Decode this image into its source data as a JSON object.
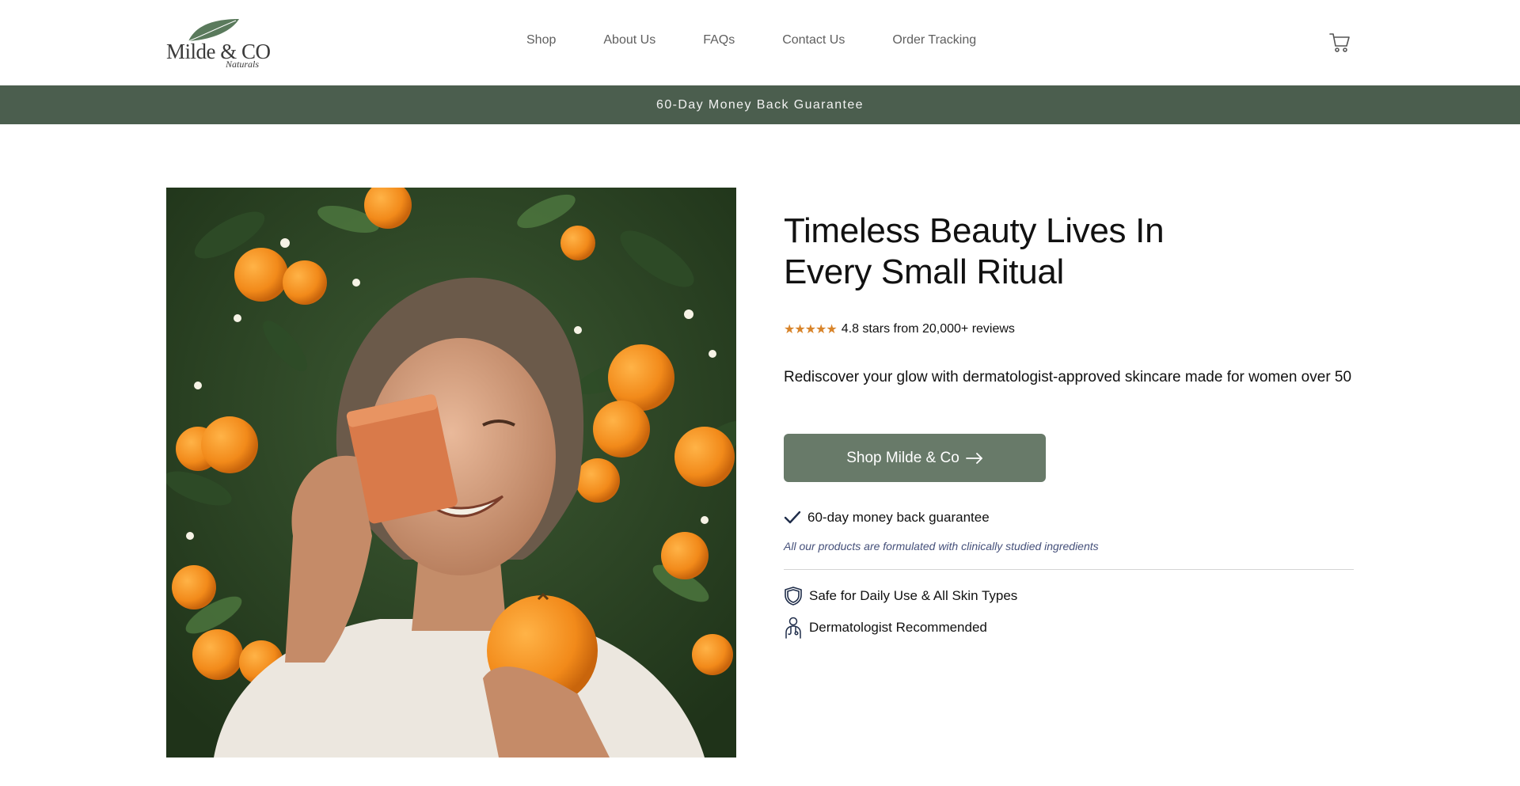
{
  "header": {
    "logo": {
      "main": "Milde & CO",
      "sub": "Naturals"
    },
    "nav": [
      "Shop",
      "About Us",
      "FAQs",
      "Contact Us",
      "Order Tracking"
    ],
    "cart_icon": "cart-icon"
  },
  "announcement": {
    "text": "60-Day Money Back Guarantee"
  },
  "hero": {
    "image_alt_icon": "hero-photo",
    "title_line1": "Timeless Beauty Lives In",
    "title_line2": "Every Small Ritual",
    "stars": "★★★★★",
    "rating_text": "4.8 stars from 20,000+ reviews",
    "subtitle": "Rediscover your glow with dermatologist-approved skincare made for women over 50",
    "cta_label": "Shop Milde & Co",
    "guarantee_text": "60-day money back guarantee",
    "formulated_text": "All our products are formulated with clinically studied ingredients",
    "features": [
      {
        "icon": "shield-icon",
        "text": "Safe for Daily Use & All Skin Types"
      },
      {
        "icon": "doctor-icon",
        "text": "Dermatologist Recommended"
      }
    ]
  },
  "colors": {
    "announcement_bg": "#4b5e4e",
    "cta_bg": "#687a69",
    "star": "#d8842a",
    "italic_note": "#45507a"
  }
}
